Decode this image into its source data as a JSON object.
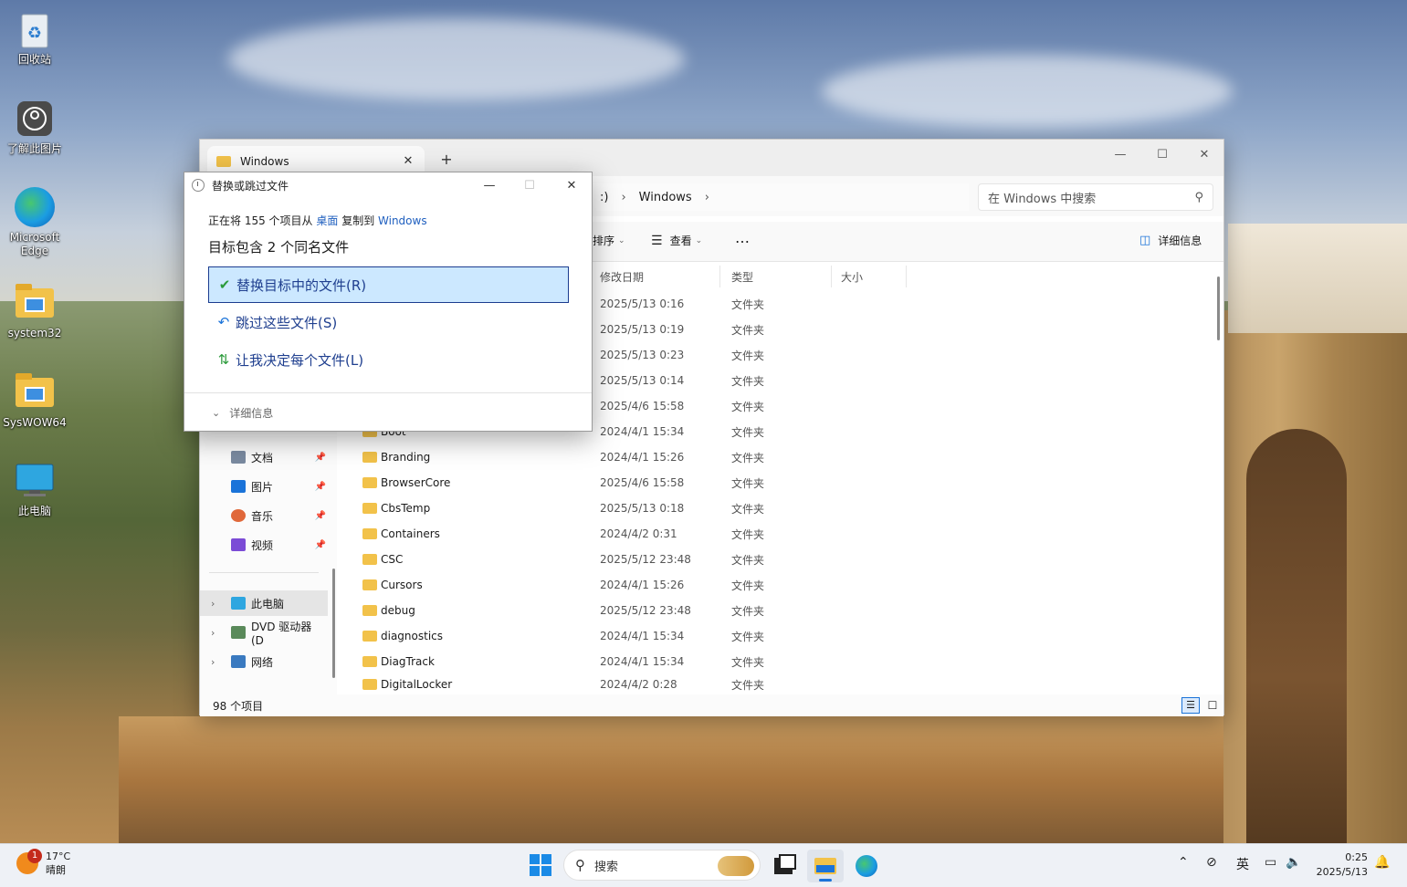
{
  "desktop": {
    "icons": [
      {
        "label": "回收站"
      },
      {
        "label": "了解此图片"
      },
      {
        "label": "Microsoft Edge"
      },
      {
        "label": "system32"
      },
      {
        "label": "SysWOW64"
      },
      {
        "label": "此电脑"
      }
    ]
  },
  "explorer": {
    "tab_title": "Windows",
    "breadcrumb_partial": ":)",
    "breadcrumb_current": "Windows",
    "search_placeholder": "在 Windows 中搜索",
    "cmd": {
      "sort": "排序",
      "view": "查看",
      "more": "…",
      "details": "详细信息"
    },
    "columns": {
      "date": "修改日期",
      "type": "类型",
      "size": "大小"
    },
    "hidden_rows": [
      {
        "date": "2025/5/13 0:16",
        "type": "文件夹"
      },
      {
        "date": "2025/5/13 0:19",
        "type": "文件夹"
      },
      {
        "date": "2025/5/13 0:23",
        "type": "文件夹"
      },
      {
        "date": "2025/5/13 0:14",
        "type": "文件夹"
      },
      {
        "date": "2025/4/6 15:58",
        "type": "文件夹"
      }
    ],
    "rows": [
      {
        "name": "Boot",
        "date": "2024/4/1 15:34",
        "type": "文件夹"
      },
      {
        "name": "Branding",
        "date": "2024/4/1 15:26",
        "type": "文件夹"
      },
      {
        "name": "BrowserCore",
        "date": "2025/4/6 15:58",
        "type": "文件夹"
      },
      {
        "name": "CbsTemp",
        "date": "2025/5/13 0:18",
        "type": "文件夹"
      },
      {
        "name": "Containers",
        "date": "2024/4/2 0:31",
        "type": "文件夹"
      },
      {
        "name": "CSC",
        "date": "2025/5/12 23:48",
        "type": "文件夹"
      },
      {
        "name": "Cursors",
        "date": "2024/4/1 15:26",
        "type": "文件夹"
      },
      {
        "name": "debug",
        "date": "2025/5/12 23:48",
        "type": "文件夹"
      },
      {
        "name": "diagnostics",
        "date": "2024/4/1 15:34",
        "type": "文件夹"
      },
      {
        "name": "DiagTrack",
        "date": "2024/4/1 15:34",
        "type": "文件夹"
      },
      {
        "name": "DigitalLocker",
        "date": "2024/4/2 0:28",
        "type": "文件夹"
      }
    ],
    "nav": {
      "documents": "文档",
      "pictures": "图片",
      "music": "音乐",
      "videos": "视频",
      "this_pc": "此电脑",
      "dvd": "DVD 驱动器 (D",
      "network": "网络"
    },
    "status": "98 个项目"
  },
  "dialog": {
    "title": "替换或跳过文件",
    "line1_prefix": "正在将 155 个项目从 ",
    "source": "桌面",
    "line1_mid": " 复制到 ",
    "dest": "Windows",
    "line2": "目标包含 2 个同名文件",
    "options": {
      "replace": "替换目标中的文件(R)",
      "skip": "跳过这些文件(S)",
      "decide": "让我决定每个文件(L)"
    },
    "details": "详细信息"
  },
  "taskbar": {
    "weather_badge": "1",
    "temp": "17°C",
    "condition": "晴朗",
    "search": "搜索",
    "ime": "英",
    "time": "0:25",
    "date": "2025/5/13"
  }
}
